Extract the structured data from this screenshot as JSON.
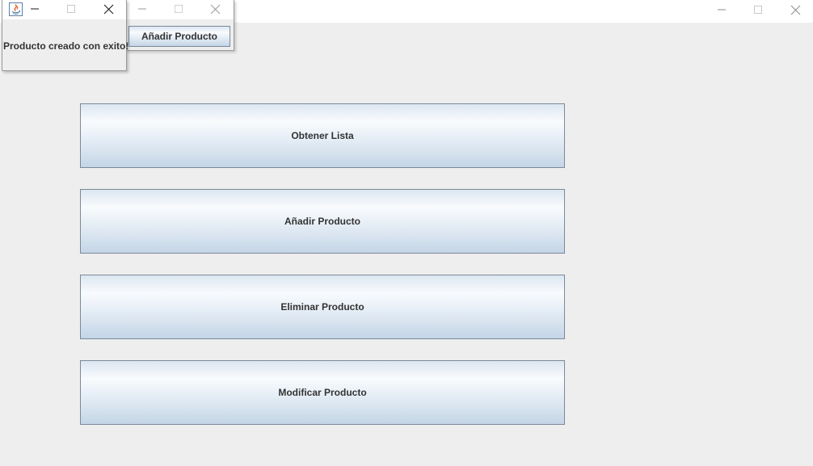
{
  "main_window": {
    "controls": {
      "minimize": "minimize-icon",
      "maximize": "maximize-icon",
      "close": "close-icon"
    },
    "buttons": [
      {
        "label": "Obtener Lista"
      },
      {
        "label": "Añadir Producto"
      },
      {
        "label": "Eliminar Producto"
      },
      {
        "label": "Modificar Producto"
      }
    ]
  },
  "add_window": {
    "button_label": "Añadir Producto"
  },
  "message_dialog": {
    "icon": "java-icon",
    "message": "Producto creado con exito!"
  },
  "colors": {
    "background": "#eeeeee",
    "titlebar": "#ffffff",
    "button_border": "#7a8a99",
    "text": "#333333"
  }
}
